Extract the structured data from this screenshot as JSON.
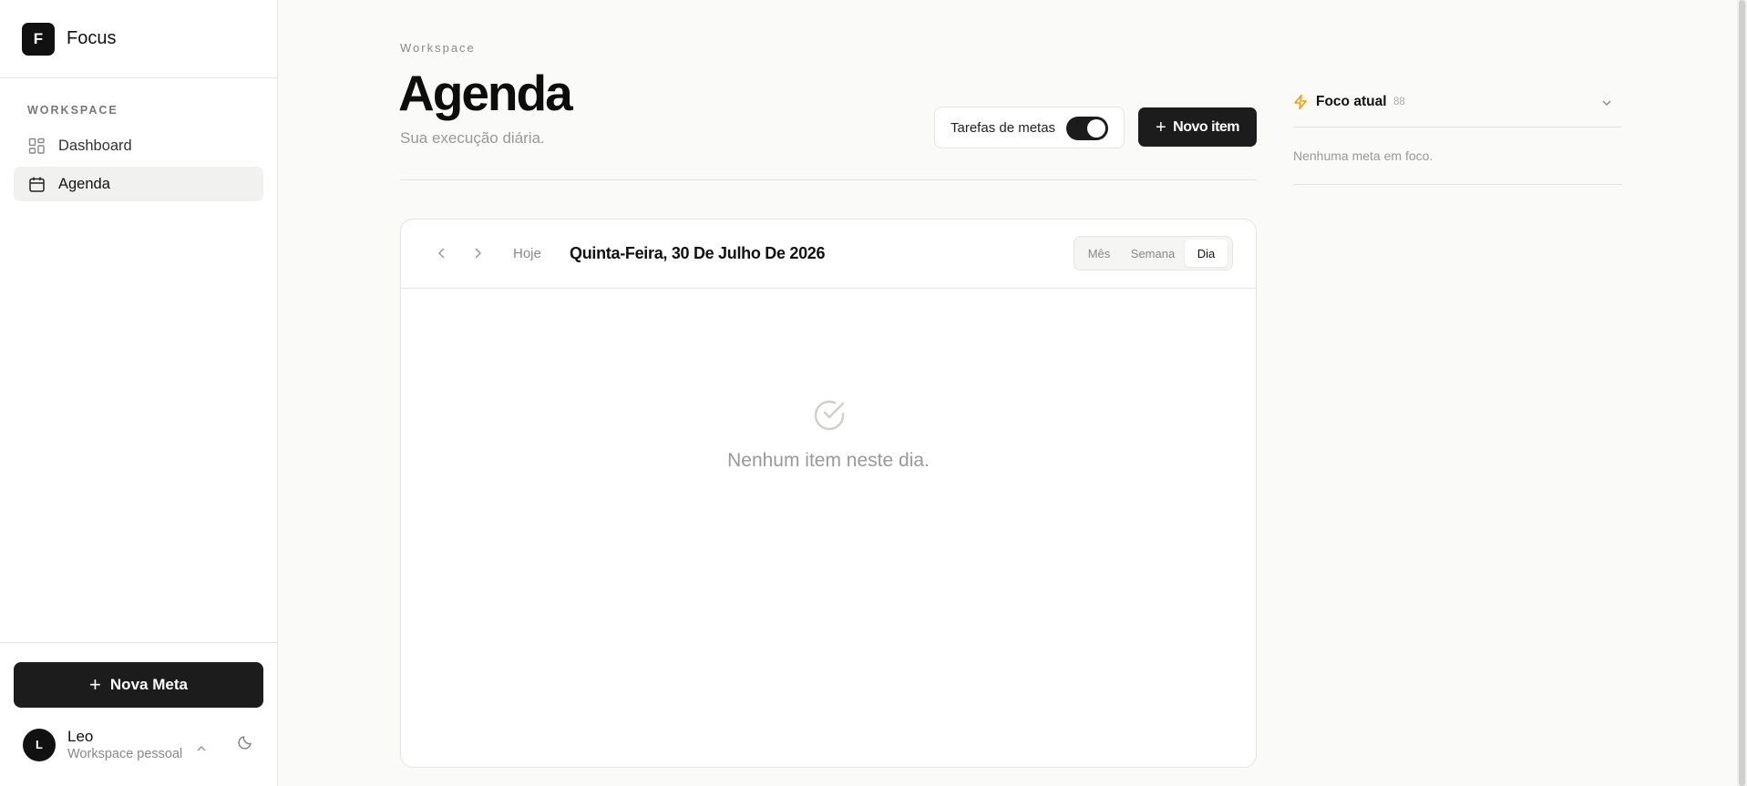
{
  "brand": {
    "logo_letter": "F",
    "name": "Focus"
  },
  "sidebar": {
    "section_label": "WORKSPACE",
    "items": [
      {
        "label": "Dashboard",
        "icon": "grid-icon",
        "active": false
      },
      {
        "label": "Agenda",
        "icon": "calendar-icon",
        "active": true
      }
    ],
    "new_goal_label": "Nova Meta",
    "user": {
      "initial": "L",
      "name": "Leo",
      "workspace": "Workspace pessoal"
    }
  },
  "header": {
    "eyebrow": "Workspace",
    "title": "Agenda",
    "subtitle": "Sua execução diária.",
    "toggle_label": "Tarefas de metas",
    "toggle_on": true,
    "new_item_label": "Novo item"
  },
  "calendar": {
    "today_label": "Hoje",
    "date_title": "Quinta-Feira, 30 De Julho De 2026",
    "views": [
      "Mês",
      "Semana",
      "Dia"
    ],
    "active_view": "Dia",
    "empty_message": "Nenhum item neste dia."
  },
  "focus_panel": {
    "title": "Foco atual",
    "count": "88",
    "empty_message": "Nenhuma meta em foco."
  },
  "colors": {
    "accent_dark": "#1c1c1c",
    "bolt": "#f59e0b",
    "background": "#fafaf9"
  }
}
